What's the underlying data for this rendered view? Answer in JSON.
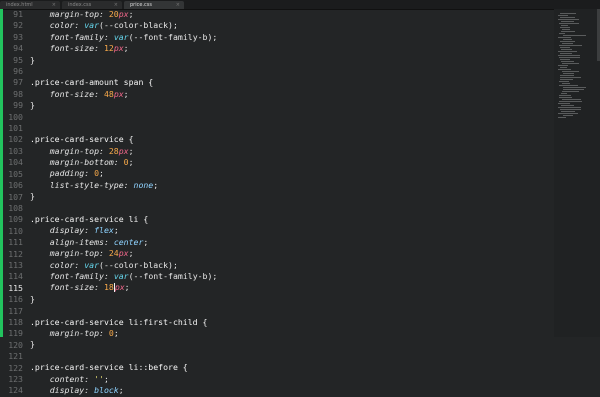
{
  "tabs": [
    {
      "label": "index.html",
      "active": false
    },
    {
      "label": "index.css",
      "active": false
    },
    {
      "label": "price.css",
      "active": true
    }
  ],
  "gutter": [
    "91",
    "92",
    "93",
    "94",
    "95",
    "96",
    "97",
    "98",
    "99",
    "100",
    "101",
    "102",
    "103",
    "104",
    "105",
    "106",
    "107",
    "108",
    "109",
    "110",
    "111",
    "112",
    "113",
    "114",
    "115",
    "116",
    "117",
    "118",
    "119",
    "120",
    "121",
    "122",
    "123",
    "124"
  ],
  "current_line": "115",
  "colors": {
    "accent_gutter": "#22c35e",
    "background": "#232526"
  },
  "code": [
    [
      [
        "prop",
        "    margin-top: "
      ],
      [
        "num",
        "20"
      ],
      [
        "unit",
        "px"
      ],
      [
        "punct",
        ";"
      ]
    ],
    [
      [
        "prop",
        "    color: "
      ],
      [
        "fn",
        "var"
      ],
      [
        "punct",
        "(--color-black);"
      ]
    ],
    [
      [
        "prop",
        "    font-family: "
      ],
      [
        "fn",
        "var"
      ],
      [
        "punct",
        "(--font-family-b);"
      ]
    ],
    [
      [
        "prop",
        "    font-size: "
      ],
      [
        "num",
        "12"
      ],
      [
        "unit",
        "px"
      ],
      [
        "punct",
        ";"
      ]
    ],
    [
      [
        "punct",
        "}"
      ]
    ],
    [
      [
        "punct",
        ""
      ]
    ],
    [
      [
        "sel",
        ".price-card-amount span {"
      ]
    ],
    [
      [
        "prop",
        "    font-size: "
      ],
      [
        "num",
        "48"
      ],
      [
        "unit",
        "px"
      ],
      [
        "punct",
        ";"
      ]
    ],
    [
      [
        "punct",
        "}"
      ]
    ],
    [
      [
        "punct",
        ""
      ]
    ],
    [
      [
        "punct",
        ""
      ]
    ],
    [
      [
        "sel",
        ".price-card-service {"
      ]
    ],
    [
      [
        "prop",
        "    margin-top: "
      ],
      [
        "num",
        "28"
      ],
      [
        "unit",
        "px"
      ],
      [
        "punct",
        ";"
      ]
    ],
    [
      [
        "prop",
        "    margin-bottom: "
      ],
      [
        "num",
        "0"
      ],
      [
        "punct",
        ";"
      ]
    ],
    [
      [
        "prop",
        "    padding: "
      ],
      [
        "num",
        "0"
      ],
      [
        "punct",
        ";"
      ]
    ],
    [
      [
        "prop",
        "    list-style-type: "
      ],
      [
        "kw",
        "none"
      ],
      [
        "punct",
        ";"
      ]
    ],
    [
      [
        "punct",
        "}"
      ]
    ],
    [
      [
        "punct",
        ""
      ]
    ],
    [
      [
        "sel",
        ".price-card-service li {"
      ]
    ],
    [
      [
        "prop",
        "    display: "
      ],
      [
        "kw",
        "flex"
      ],
      [
        "punct",
        ";"
      ]
    ],
    [
      [
        "prop",
        "    align-items: "
      ],
      [
        "kw",
        "center"
      ],
      [
        "punct",
        ";"
      ]
    ],
    [
      [
        "prop",
        "    margin-top: "
      ],
      [
        "num",
        "24"
      ],
      [
        "unit",
        "px"
      ],
      [
        "punct",
        ";"
      ]
    ],
    [
      [
        "prop",
        "    color: "
      ],
      [
        "fn",
        "var"
      ],
      [
        "punct",
        "(--color-black);"
      ]
    ],
    [
      [
        "prop",
        "    font-family: "
      ],
      [
        "fn",
        "var"
      ],
      [
        "punct",
        "(--font-family-b);"
      ]
    ],
    [
      [
        "prop",
        "    font-size: "
      ],
      [
        "num",
        "18"
      ],
      [
        "unit",
        "px"
      ],
      [
        "punct",
        ";"
      ]
    ],
    [
      [
        "punct",
        "}"
      ]
    ],
    [
      [
        "punct",
        ""
      ]
    ],
    [
      [
        "sel",
        ".price-card-service li:first-child {"
      ]
    ],
    [
      [
        "prop",
        "    margin-top: "
      ],
      [
        "num",
        "0"
      ],
      [
        "punct",
        ";"
      ]
    ],
    [
      [
        "punct",
        "}"
      ]
    ],
    [
      [
        "punct",
        ""
      ]
    ],
    [
      [
        "sel",
        ".price-card-service li::before {"
      ]
    ],
    [
      [
        "prop",
        "    content: "
      ],
      [
        "str",
        "''"
      ],
      [
        "punct",
        ";"
      ]
    ],
    [
      [
        "prop",
        "    display: "
      ],
      [
        "kw",
        "block"
      ],
      [
        "punct",
        ";"
      ]
    ]
  ]
}
